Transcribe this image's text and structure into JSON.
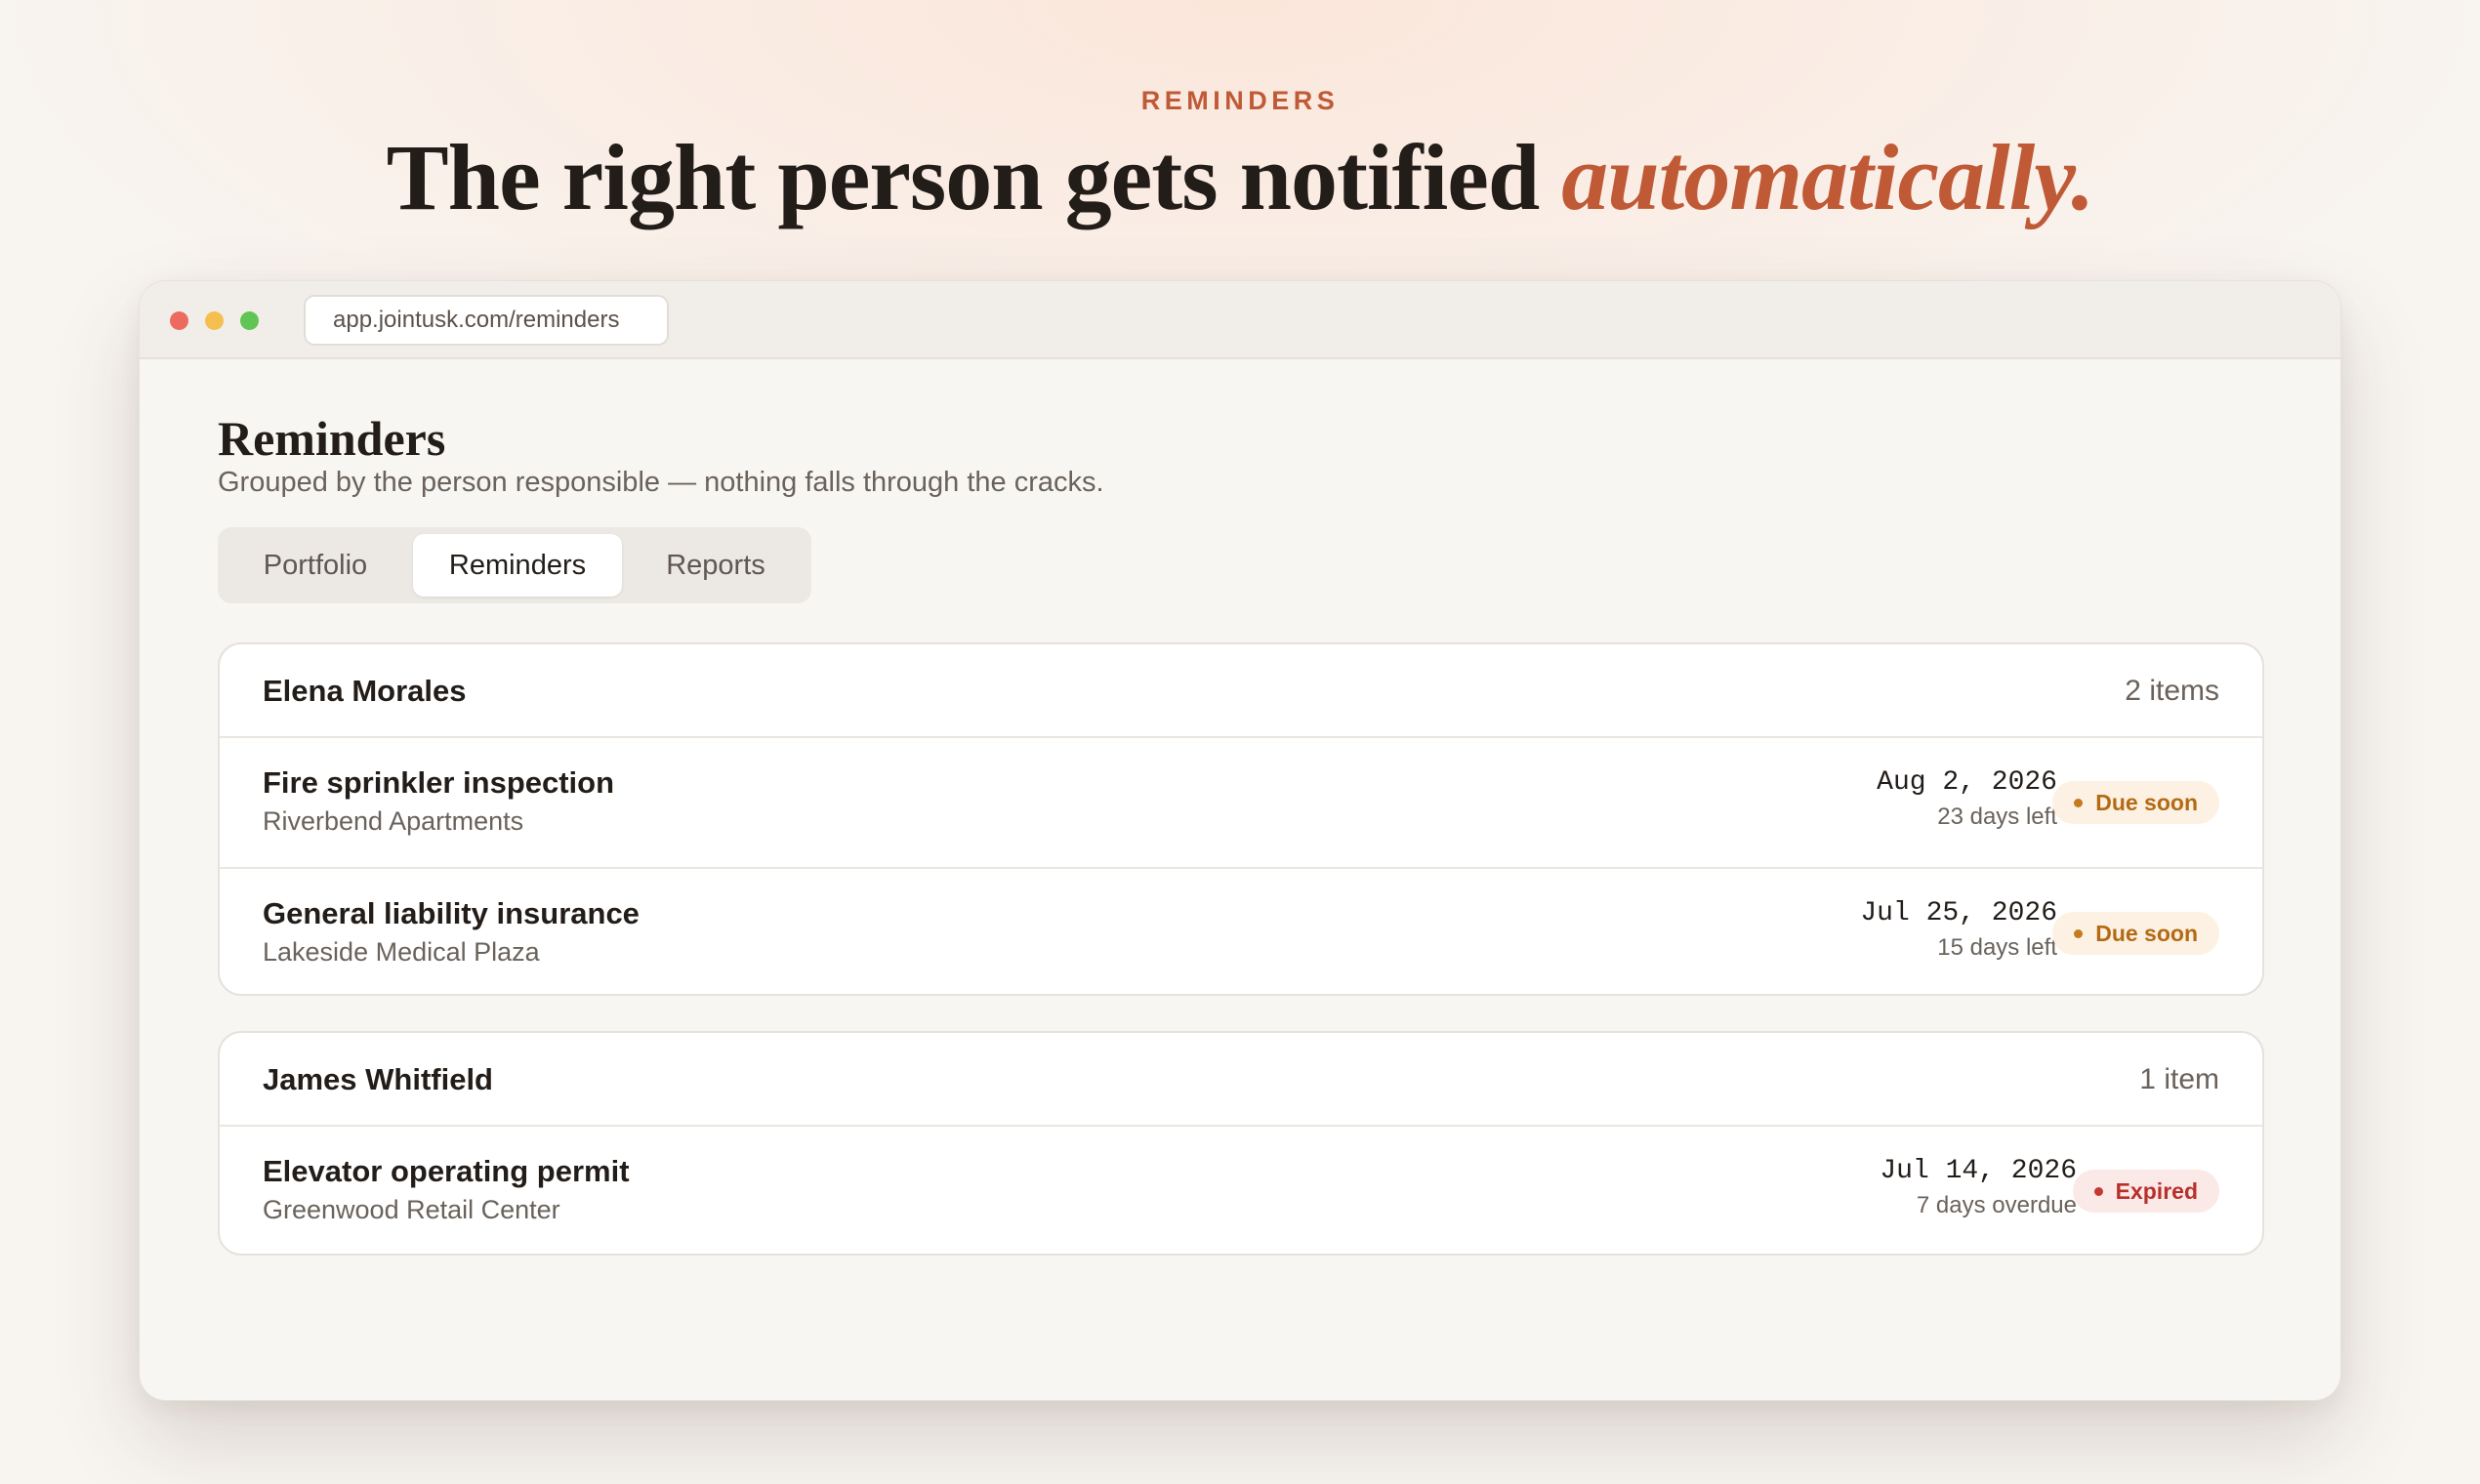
{
  "hero": {
    "eyebrow": "REMINDERS",
    "headline_main": "The right person gets notified ",
    "headline_accent": "automatically."
  },
  "browser": {
    "url": "app.jointusk.com/reminders"
  },
  "page": {
    "title": "Reminders",
    "subtitle": "Grouped by the person responsible — nothing falls through the cracks."
  },
  "tabs": [
    {
      "label": "Portfolio",
      "active": false
    },
    {
      "label": "Reminders",
      "active": true
    },
    {
      "label": "Reports",
      "active": false
    }
  ],
  "groups": [
    {
      "owner": "Elena Morales",
      "count": "2 items",
      "items": [
        {
          "title": "Fire sprinkler inspection",
          "property": "Riverbend Apartments",
          "date": "Aug 2, 2026",
          "relative": "23 days left",
          "status": "Due soon",
          "status_color": "#b46a14"
        },
        {
          "title": "General liability insurance",
          "property": "Lakeside Medical Plaza",
          "date": "Jul 25, 2026",
          "relative": "15 days left",
          "status": "Due soon",
          "status_color": "#b46a14"
        }
      ]
    },
    {
      "owner": "James Whitfield",
      "count": "1 item",
      "items": [
        {
          "title": "Elevator operating permit",
          "property": "Greenwood Retail Center",
          "date": "Jul 14, 2026",
          "relative": "7 days overdue",
          "status": "Expired",
          "status_color": "#b8302a"
        }
      ]
    }
  ],
  "colors": {
    "accent": "#c05a36",
    "due_soon": "#b46a14",
    "expired": "#b8302a"
  }
}
